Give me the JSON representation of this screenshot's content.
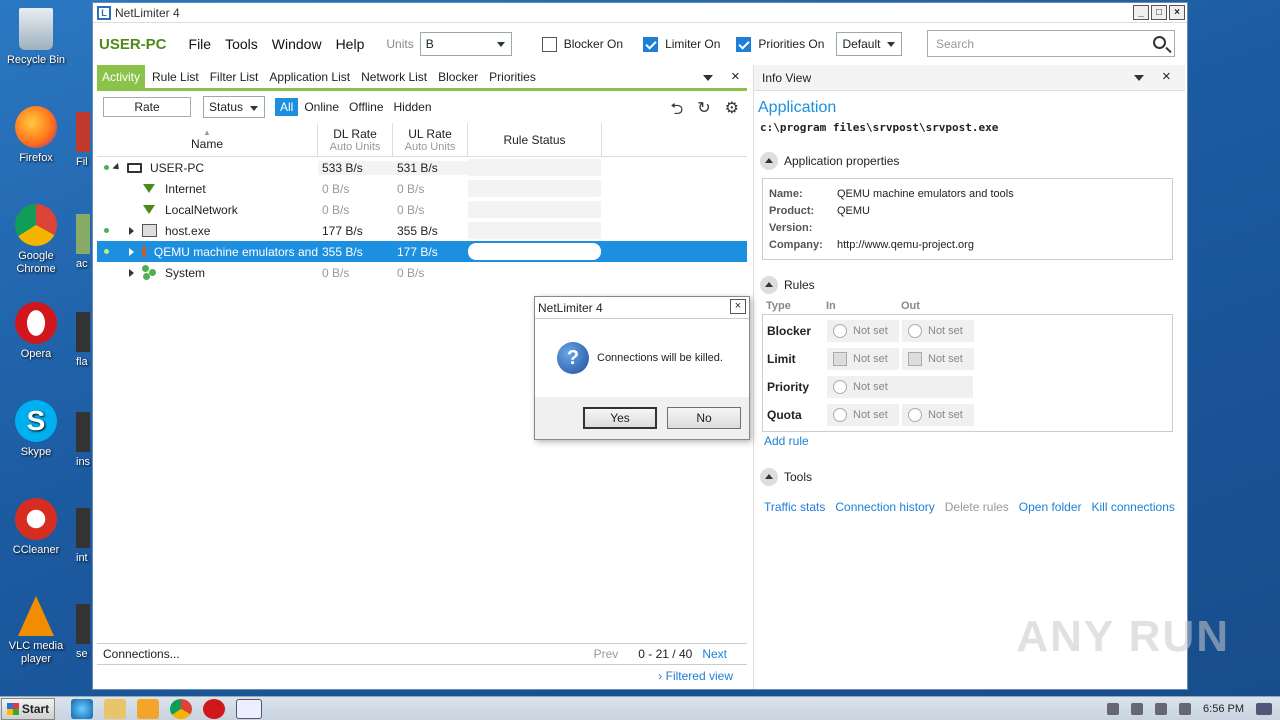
{
  "desktop": {
    "icons": [
      "Recycle Bin",
      "Firefox",
      "Google Chrome",
      "Opera",
      "Skype",
      "CCleaner",
      "VLC media player"
    ],
    "peek_labels": [
      "Fil",
      "ac",
      "fla",
      "ins",
      "int",
      "se"
    ]
  },
  "window": {
    "title": "NetLimiter 4",
    "minimize": "_",
    "maximize": "□",
    "close": "×"
  },
  "menubar": {
    "host": "USER-PC",
    "items": [
      "File",
      "Tools",
      "Window",
      "Help"
    ],
    "units_label": "Units",
    "units_value": "B",
    "blocker_label": "Blocker On",
    "limiter_label": "Limiter On",
    "priorities_label": "Priorities On",
    "profile_value": "Default",
    "search_placeholder": "Search",
    "blocker_checked": false,
    "limiter_checked": true,
    "priorities_checked": true
  },
  "tabs": [
    "Activity",
    "Rule List",
    "Filter List",
    "Application List",
    "Network List",
    "Blocker",
    "Priorities"
  ],
  "filterbar": {
    "rate": "Rate",
    "status": "Status",
    "all": "All",
    "online": "Online",
    "offline": "Offline",
    "hidden": "Hidden"
  },
  "grid": {
    "headers": {
      "name": "Name",
      "dl": "DL Rate",
      "dl_sub": "Auto Units",
      "ul": "UL Rate",
      "ul_sub": "Auto Units",
      "rule": "Rule Status"
    },
    "rows": [
      {
        "name": "USER-PC",
        "dl": "533 B/s",
        "ul": "531 B/s"
      },
      {
        "name": "Internet",
        "dl": "0 B/s",
        "ul": "0 B/s"
      },
      {
        "name": "LocalNetwork",
        "dl": "0 B/s",
        "ul": "0 B/s"
      },
      {
        "name": "host.exe",
        "dl": "177 B/s",
        "ul": "355 B/s"
      },
      {
        "name": "QEMU machine emulators and",
        "dl": "355 B/s",
        "ul": "177 B/s"
      },
      {
        "name": "System",
        "dl": "0 B/s",
        "ul": "0 B/s"
      }
    ]
  },
  "statusbar": {
    "connections": "Connections...",
    "prev": "Prev",
    "range": "0 - 21 / 40",
    "next": "Next",
    "filtered": "Filtered view"
  },
  "info": {
    "header": "Info View",
    "title": "Application",
    "path": "c:\\program files\\srvpost\\srvpost.exe",
    "props_title": "Application properties",
    "props": [
      {
        "k": "Name:",
        "v": "QEMU machine emulators and tools"
      },
      {
        "k": "Product:",
        "v": "QEMU"
      },
      {
        "k": "Version:",
        "v": ""
      },
      {
        "k": "Company:",
        "v": "http://www.qemu-project.org"
      }
    ],
    "rules_title": "Rules",
    "rules_cols": {
      "type": "Type",
      "in": "In",
      "out": "Out"
    },
    "rules": [
      {
        "type": "Blocker",
        "in": "Not set",
        "out": "Not set"
      },
      {
        "type": "Limit",
        "in": "Not set",
        "out": "Not set"
      },
      {
        "type": "Priority",
        "in": "Not set",
        "out": ""
      },
      {
        "type": "Quota",
        "in": "Not set",
        "out": "Not set"
      }
    ],
    "add_rule": "Add rule",
    "tools_title": "Tools",
    "tools": [
      "Traffic stats",
      "Connection history",
      "Delete rules",
      "Open folder",
      "Kill connections"
    ]
  },
  "dialog": {
    "title": "NetLimiter 4",
    "message": "Connections will be killed.",
    "yes": "Yes",
    "no": "No",
    "close": "×"
  },
  "watermark": "ANY RUN",
  "taskbar": {
    "start": "Start",
    "clock": "6:56 PM"
  }
}
